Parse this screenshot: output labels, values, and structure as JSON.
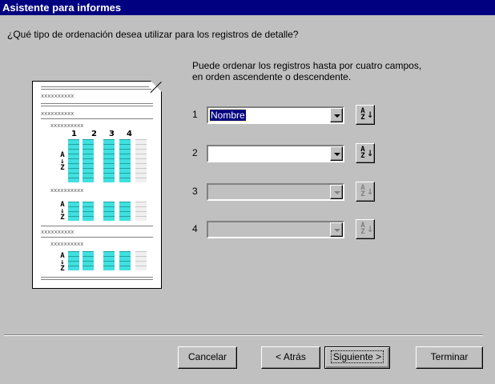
{
  "window": {
    "title": "Asistente para informes"
  },
  "question": "¿Qué tipo de ordenación desea utilizar para los registros de detalle?",
  "hint": [
    "Puede ordenar los registros hasta por cuatro campos,",
    "en orden ascendente o descendente."
  ],
  "sort_fields": [
    {
      "number": "1",
      "value": "Nombre",
      "enabled": true
    },
    {
      "number": "2",
      "value": "",
      "enabled": true
    },
    {
      "number": "3",
      "value": "",
      "enabled": false
    },
    {
      "number": "4",
      "value": "",
      "enabled": false
    }
  ],
  "sort_button_glyph": {
    "top": "A",
    "bottom": "Z",
    "arrow": "↓"
  },
  "preview": {
    "placeholder": "xxxxxxxxxx",
    "cell_text": "xxxx",
    "columns": [
      "1",
      "2",
      "3",
      "4"
    ],
    "az_glyph": {
      "top": "A",
      "bottom": "Z",
      "arrow": "↓"
    }
  },
  "buttons": {
    "cancel": "Cancelar",
    "back": "< Atrás",
    "next": "Siguiente >",
    "finish": "Terminar"
  },
  "colors": {
    "titlebar": "#000080",
    "face": "#c0c0c0",
    "preview_highlight": "#40e0e0"
  }
}
